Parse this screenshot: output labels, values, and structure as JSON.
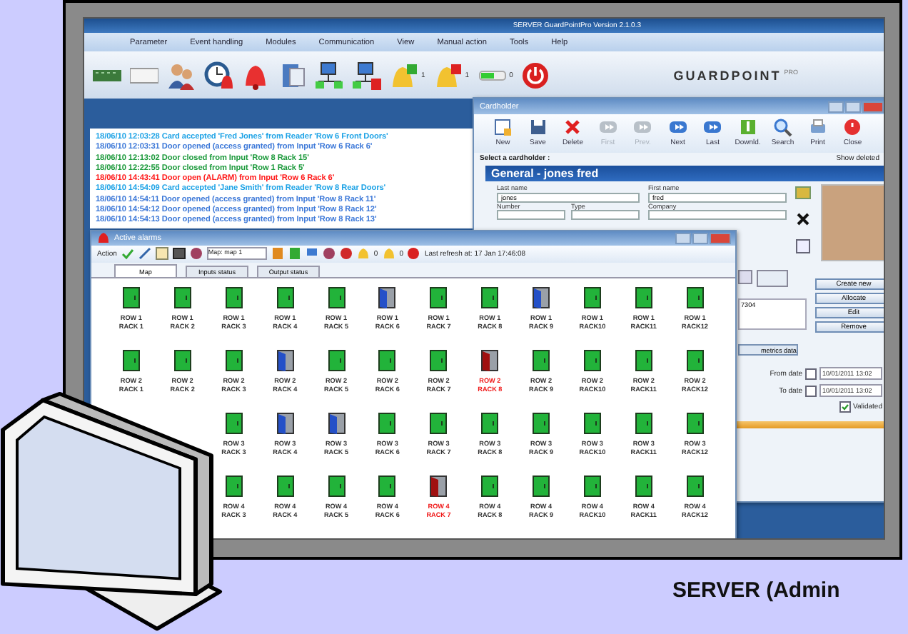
{
  "main_window": {
    "title": "SERVER GuardPointPro Version 2.1.0.3",
    "menu": [
      "Parameter",
      "Event handling",
      "Modules",
      "Communication",
      "View",
      "Manual action",
      "Tools",
      "Help"
    ],
    "alarm_counts": [
      "1",
      "1",
      "0"
    ],
    "logo": {
      "name": "GUARDPOINT",
      "suffix": "PRO"
    },
    "events": [
      {
        "text": "18/06/10 12:03:28 Card accepted 'Fred Jones' from Reader 'Row 6 Front Doors'",
        "color": "#1ea3e6"
      },
      {
        "text": "18/06/10 12:03:31 Door opened (access granted) from Input 'Row 6 Rack 6'",
        "color": "#3c78d8"
      },
      {
        "text": "18/06/10 12:13:02 Door closed from Input 'Row 8 Rack 15'",
        "color": "#1d9a3c"
      },
      {
        "text": "18/06/10 12:22:55 Door closed from Input 'Row 1 Rack 5'",
        "color": "#1d9a3c"
      },
      {
        "text": "18/06/10 14:43:41 Door open (ALARM) from Input 'Row 6 Rack 6'",
        "color": "#ff1a1a"
      },
      {
        "text": "18/06/10 14:54:09 Card accepted 'Jane Smith' from Reader 'Row 8 Rear Doors'",
        "color": "#1ea3e6"
      },
      {
        "text": "18/06/10 14:54:11 Door opened (access granted) from Input 'Row 8 Rack 11'",
        "color": "#3c78d8"
      },
      {
        "text": "18/06/10 14:54:12 Door opened (access granted) from Input 'Row 8 Rack 12'",
        "color": "#3c78d8"
      },
      {
        "text": "18/06/10 14:54:13 Door opened (access granted) from Input 'Row 8 Rack 13'",
        "color": "#3c78d8"
      }
    ]
  },
  "cardholder_window": {
    "title": "Cardholder",
    "toolbar": [
      {
        "kind": "new",
        "label": "New",
        "disabled": false
      },
      {
        "kind": "save",
        "label": "Save",
        "disabled": false
      },
      {
        "kind": "delete",
        "label": "Delete",
        "disabled": false
      },
      {
        "kind": "first",
        "label": "First",
        "disabled": true
      },
      {
        "kind": "prev",
        "label": "Prev.",
        "disabled": true
      },
      {
        "kind": "next",
        "label": "Next",
        "disabled": false
      },
      {
        "kind": "last",
        "label": "Last",
        "disabled": false
      },
      {
        "kind": "download",
        "label": "Downld.",
        "disabled": false
      },
      {
        "kind": "search",
        "label": "Search",
        "disabled": false
      },
      {
        "kind": "print",
        "label": "Print",
        "disabled": false
      },
      {
        "kind": "close",
        "label": "Close",
        "disabled": false
      }
    ],
    "select_label": "Select a cardholder :",
    "show_deleted": "Show deleted",
    "header": "General - jones fred",
    "last_name": {
      "label": "Last name",
      "value": "jones"
    },
    "first_name": {
      "label": "First name",
      "value": "fred"
    },
    "number": {
      "label": "Number"
    },
    "type": {
      "label": "Type"
    },
    "company": {
      "label": "Company"
    },
    "card_number": "7304",
    "metrics_button": "metrics data",
    "buttons": [
      "Create new",
      "Allocate",
      "Edit",
      "Remove"
    ],
    "from_date": {
      "label": "From date",
      "value": "10/01/2011 13:02",
      "checked": false
    },
    "to_date": {
      "label": "To date",
      "value": "10/01/2011 13:02",
      "checked": false
    },
    "validated": {
      "label": "Validated",
      "checked": true
    }
  },
  "alarms_window": {
    "title": "Active alarms",
    "action": "Action",
    "map_select": "Map: map 1",
    "counts": [
      "0",
      "0"
    ],
    "refresh": "Last refresh at: 17 Jan 17:46:08",
    "tabs": [
      {
        "label": "Map",
        "selected": true
      },
      {
        "label": "Inputs status",
        "selected": false
      },
      {
        "label": "Output status",
        "selected": false
      }
    ],
    "rows": [
      {
        "cells": [
          {
            "row": "ROW 1",
            "rack": "RACK 1",
            "kind": "closed"
          },
          {
            "row": "ROW 1",
            "rack": "RACK 2",
            "kind": "closed"
          },
          {
            "row": "ROW 1",
            "rack": "RACK 3",
            "kind": "closed"
          },
          {
            "row": "ROW 1",
            "rack": "RACK 4",
            "kind": "closed"
          },
          {
            "row": "ROW 1",
            "rack": "RACK 5",
            "kind": "closed"
          },
          {
            "row": "ROW 1",
            "rack": "RACK 6",
            "kind": "open"
          },
          {
            "row": "ROW 1",
            "rack": "RACK 7",
            "kind": "closed"
          },
          {
            "row": "ROW 1",
            "rack": "RACK 8",
            "kind": "closed"
          },
          {
            "row": "ROW 1",
            "rack": "RACK 9",
            "kind": "open"
          },
          {
            "row": "ROW 1",
            "rack": "RACK10",
            "kind": "closed"
          },
          {
            "row": "ROW 1",
            "rack": "RACK11",
            "kind": "closed"
          },
          {
            "row": "ROW 1",
            "rack": "RACK12",
            "kind": "closed"
          }
        ]
      },
      {
        "cells": [
          {
            "row": "ROW 2",
            "rack": "RACK 1",
            "kind": "closed"
          },
          {
            "row": "ROW 2",
            "rack": "RACK 2",
            "kind": "closed"
          },
          {
            "row": "ROW 2",
            "rack": "RACK 3",
            "kind": "closed"
          },
          {
            "row": "ROW 2",
            "rack": "RACK 4",
            "kind": "open"
          },
          {
            "row": "ROW 2",
            "rack": "RACK 5",
            "kind": "closed"
          },
          {
            "row": "ROW 2",
            "rack": "RACK 6",
            "kind": "closed"
          },
          {
            "row": "ROW 2",
            "rack": "RACK 7",
            "kind": "closed"
          },
          {
            "row": "ROW 2",
            "rack": "RACK 8",
            "kind": "alarm"
          },
          {
            "row": "ROW 2",
            "rack": "RACK 9",
            "kind": "closed"
          },
          {
            "row": "ROW 2",
            "rack": "RACK10",
            "kind": "closed"
          },
          {
            "row": "ROW 2",
            "rack": "RACK11",
            "kind": "closed"
          },
          {
            "row": "ROW 2",
            "rack": "RACK12",
            "kind": "closed"
          }
        ]
      },
      {
        "cells": [
          {
            "row": "ROW 3",
            "rack": "RACK 3",
            "kind": "closed"
          },
          {
            "row": "ROW 3",
            "rack": "RACK 4",
            "kind": "open"
          },
          {
            "row": "ROW 3",
            "rack": "RACK 5",
            "kind": "open"
          },
          {
            "row": "ROW 3",
            "rack": "RACK 6",
            "kind": "closed"
          },
          {
            "row": "ROW 3",
            "rack": "RACK 7",
            "kind": "closed"
          },
          {
            "row": "ROW 3",
            "rack": "RACK 8",
            "kind": "closed"
          },
          {
            "row": "ROW 3",
            "rack": "RACK 9",
            "kind": "closed"
          },
          {
            "row": "ROW 3",
            "rack": "RACK10",
            "kind": "closed"
          },
          {
            "row": "ROW 3",
            "rack": "RACK11",
            "kind": "closed"
          },
          {
            "row": "ROW 3",
            "rack": "RACK12",
            "kind": "closed"
          }
        ]
      },
      {
        "cells": [
          {
            "row": "ROW 4",
            "rack": "RACK 3",
            "kind": "closed"
          },
          {
            "row": "ROW 4",
            "rack": "RACK 4",
            "kind": "closed"
          },
          {
            "row": "ROW 4",
            "rack": "RACK 5",
            "kind": "closed"
          },
          {
            "row": "ROW 4",
            "rack": "RACK 6",
            "kind": "closed"
          },
          {
            "row": "ROW 4",
            "rack": "RACK 7",
            "kind": "alarm"
          },
          {
            "row": "ROW 4",
            "rack": "RACK 8",
            "kind": "closed"
          },
          {
            "row": "ROW 4",
            "rack": "RACK 9",
            "kind": "closed"
          },
          {
            "row": "ROW 4",
            "rack": "RACK10",
            "kind": "closed"
          },
          {
            "row": "ROW 4",
            "rack": "RACK11",
            "kind": "closed"
          },
          {
            "row": "ROW 4",
            "rack": "RACK12",
            "kind": "closed"
          }
        ]
      }
    ]
  },
  "caption": "SERVER (Admin"
}
